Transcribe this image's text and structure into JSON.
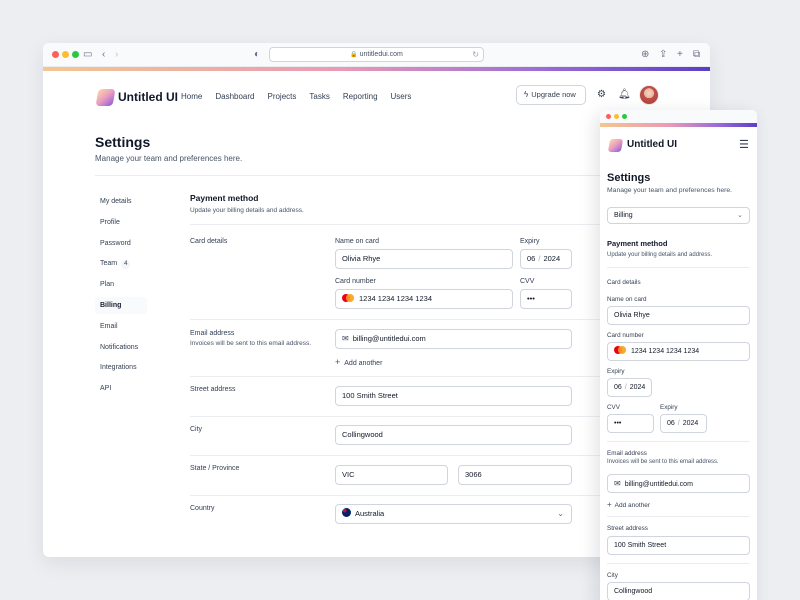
{
  "browser": {
    "url": "untitledui.com",
    "colors": {
      "close": "#ff5f57",
      "minimize": "#febc2e",
      "maximize": "#28c840"
    }
  },
  "brand": {
    "name": "Untitled UI"
  },
  "nav": {
    "links": [
      "Home",
      "Dashboard",
      "Projects",
      "Tasks",
      "Reporting",
      "Users"
    ],
    "upgrade_label": "Upgrade now"
  },
  "page": {
    "title": "Settings",
    "subtitle": "Manage your team and preferences here."
  },
  "sidebar": {
    "items": [
      {
        "label": "My details"
      },
      {
        "label": "Profile"
      },
      {
        "label": "Password"
      },
      {
        "label": "Team",
        "badge": "4"
      },
      {
        "label": "Plan"
      },
      {
        "label": "Billing",
        "active": true
      },
      {
        "label": "Email"
      },
      {
        "label": "Notifications"
      },
      {
        "label": "Integrations"
      },
      {
        "label": "API"
      }
    ]
  },
  "payment": {
    "title": "Payment method",
    "subtitle": "Update your billing details and address.",
    "card_details_label": "Card details",
    "name_on_card_label": "Name on card",
    "name_on_card": "Olivia Rhye",
    "expiry_label": "Expiry",
    "expiry_month": "06",
    "expiry_year": "2024",
    "card_number_label": "Card number",
    "card_number": "1234 1234 1234 1234",
    "cvv_label": "CVV",
    "cvv": "•••",
    "email_label": "Email address",
    "email_hint": "Invoices will be sent to this email address.",
    "email": "billing@untitledui.com",
    "add_another": "Add another",
    "street_label": "Street address",
    "street": "100 Smith Street",
    "city_label": "City",
    "city": "Collingwood",
    "state_label": "State / Province",
    "state": "VIC",
    "postcode": "3066",
    "country_label": "Country",
    "country": "Australia"
  },
  "mobile": {
    "select_value": "Billing"
  }
}
